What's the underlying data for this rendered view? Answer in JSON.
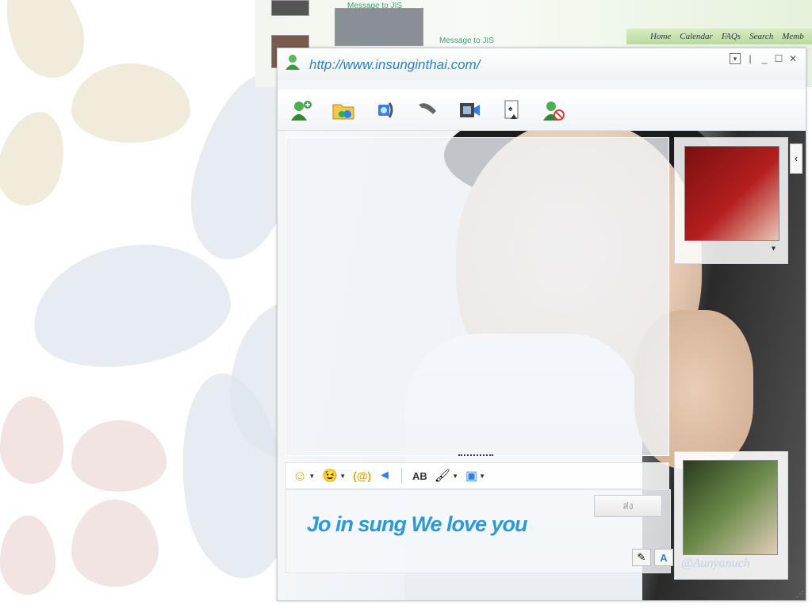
{
  "background": {
    "nav_links": [
      "Home",
      "Calendar",
      "FAQs",
      "Search",
      "Memb"
    ],
    "messages": [
      "Message to JIS",
      "Message to JIS"
    ]
  },
  "window": {
    "title_url": "http://www.insunginthai.com/",
    "controls": {
      "menu_label": "▾",
      "minimize_label": "_",
      "maximize_label": "☐",
      "close_label": "✕"
    }
  },
  "toolbar": {
    "items": [
      {
        "name": "invite-contact",
        "icon": "add-user-icon"
      },
      {
        "name": "send-files",
        "icon": "folder-share-icon"
      },
      {
        "name": "video-call",
        "icon": "webcam-phone-icon"
      },
      {
        "name": "voice-call",
        "icon": "phone-icon"
      },
      {
        "name": "activities",
        "icon": "film-icon"
      },
      {
        "name": "games",
        "icon": "game-card-icon"
      },
      {
        "name": "block",
        "icon": "block-user-icon"
      }
    ]
  },
  "format_bar": {
    "emoticon": "☺",
    "wink": "😉",
    "nudge": "(@)",
    "voice_clip": "◄",
    "font": "AB",
    "background": "🖌",
    "more": "▣"
  },
  "compose": {
    "text": "Jo in sung We love you",
    "send_label": "ส่ง",
    "handwriting_tool": "✎",
    "font_tool": "A"
  },
  "right_panel": {
    "collapse": "‹",
    "dropdown": "▼",
    "signature": "@Aunyanuch"
  },
  "colors": {
    "accent": "#2a9ad9",
    "title": "#2a7fc4",
    "nav_bg": "#c4e0a8"
  }
}
